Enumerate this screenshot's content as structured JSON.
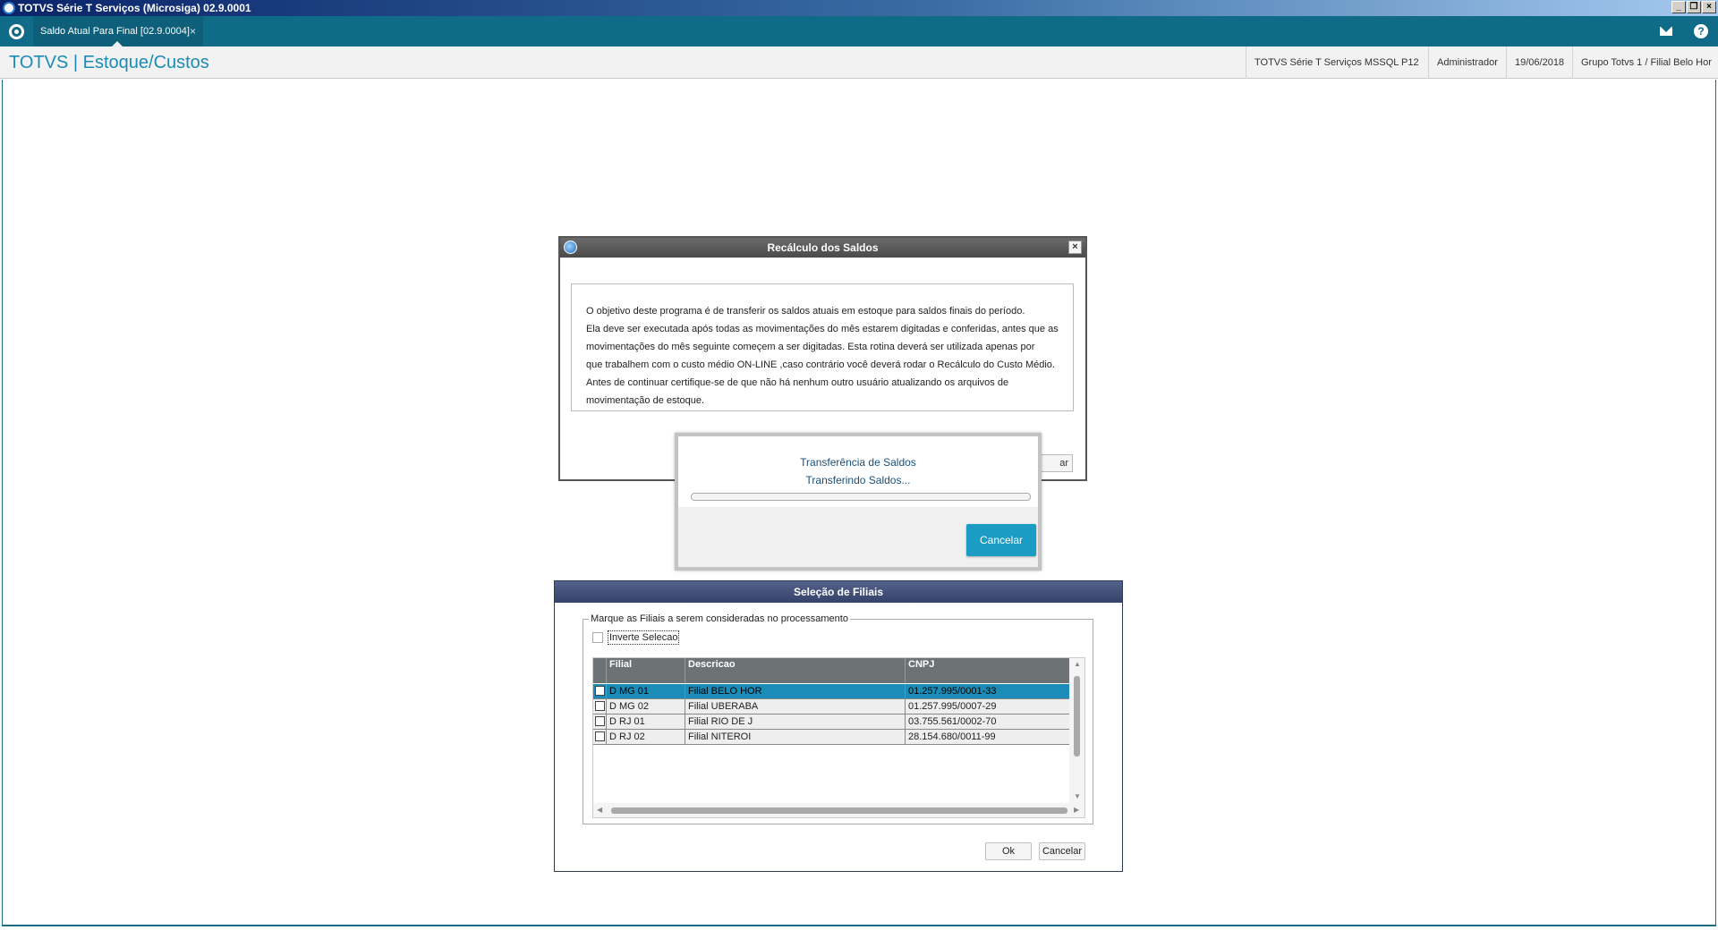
{
  "os_window": {
    "title": "TOTVS Série T Serviços (Microsiga) 02.9.0001"
  },
  "tabbar": {
    "active_tab": "Saldo Atual Para Final [02.9.0004]",
    "close_glyph": "×"
  },
  "header": {
    "brand": "TOTVS | Estoque/Custos",
    "environment": "TOTVS Série T Serviços MSSQL P12",
    "user": "Administrador",
    "date": "19/06/2018",
    "branch": "Grupo Totvs 1 / Filial Belo Hor"
  },
  "recalc_dialog": {
    "title": "Recálculo dos Saldos",
    "lines": [
      "O objetivo deste programa é de transferir os saldos atuais em estoque para saldos finais do período.",
      "Ela deve ser executada após todas as movimentações do mês estarem digitadas e conferidas, antes que as",
      "movimentações do mês seguinte começem a ser digitadas. Esta rotina deverá ser utilizada apenas por",
      "que trabalhem com o custo médio ON-LINE ,caso contrário você deverá rodar o Recálculo do Custo Médio.",
      "Antes de continuar certifique-se de que não há nenhum outro usuário atualizando os arquivos de",
      "movimentação de estoque."
    ],
    "partial_button_text": "ar"
  },
  "progress_dialog": {
    "title": "Transferência de Saldos",
    "status": "Transferindo Saldos...",
    "progress": 0,
    "cancel_label": "Cancelar"
  },
  "filiais_dialog": {
    "title": "Seleção de Filiais",
    "group_label": "Marque as Filiais a serem consideradas no processamento",
    "invert_label": "Inverte Selecao",
    "columns": [
      "Filial",
      "Descricao",
      "CNPJ"
    ],
    "rows": [
      {
        "filial": "D MG 01",
        "descricao": "Filial BELO HOR",
        "cnpj": "01.257.995/0001-33",
        "selected": true
      },
      {
        "filial": "D MG 02",
        "descricao": "Filial UBERABA",
        "cnpj": "01.257.995/0007-29",
        "selected": false
      },
      {
        "filial": "D RJ 01",
        "descricao": "Filial RIO DE J",
        "cnpj": "03.755.561/0002-70",
        "selected": false
      },
      {
        "filial": "D RJ 02",
        "descricao": "Filial NITEROI",
        "cnpj": "28.154.680/0011-99",
        "selected": false
      }
    ],
    "ok_label": "Ok",
    "cancel_label": "Cancelar"
  },
  "colors": {
    "accent": "#1a8cb7",
    "tabbar": "#0f6b87",
    "dialog_title": "#35426a"
  },
  "icons": [
    "app-icon",
    "totvs-logo-icon",
    "mail-icon",
    "help-icon",
    "dialog-icon",
    "close-icon"
  ]
}
